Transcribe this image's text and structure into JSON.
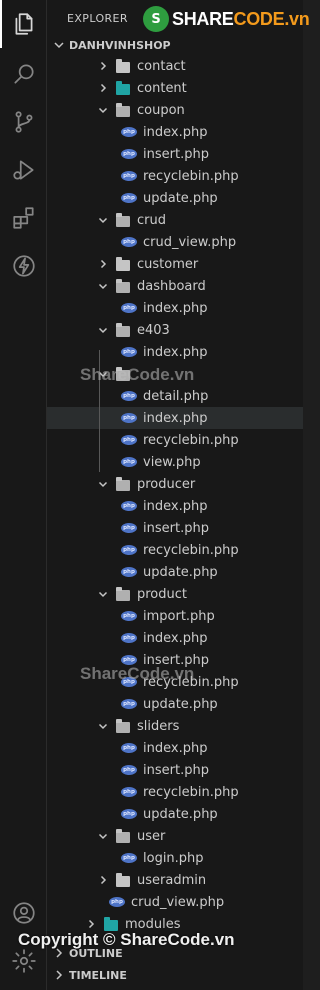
{
  "sidebar": {
    "title": "EXPLORER",
    "logo_text_a": "SHARE",
    "logo_text_b": "CODE.vn",
    "root_label": "DANHVINHSHOP"
  },
  "tree": [
    {
      "label": "contact",
      "kind": "folder",
      "state": "collapsed",
      "depth": 1
    },
    {
      "label": "content",
      "kind": "folder",
      "state": "collapsed",
      "depth": 1,
      "color": "teal"
    },
    {
      "label": "coupon",
      "kind": "folder",
      "state": "expanded",
      "depth": 1
    },
    {
      "label": "index.php",
      "kind": "php",
      "depth": 2
    },
    {
      "label": "insert.php",
      "kind": "php",
      "depth": 2
    },
    {
      "label": "recyclebin.php",
      "kind": "php",
      "depth": 2
    },
    {
      "label": "update.php",
      "kind": "php",
      "depth": 2
    },
    {
      "label": "crud",
      "kind": "folder",
      "state": "expanded",
      "depth": 1
    },
    {
      "label": "crud_view.php",
      "kind": "php",
      "depth": 2
    },
    {
      "label": "customer",
      "kind": "folder",
      "state": "collapsed",
      "depth": 1
    },
    {
      "label": "dashboard",
      "kind": "folder",
      "state": "expanded",
      "depth": 1
    },
    {
      "label": "index.php",
      "kind": "php",
      "depth": 2
    },
    {
      "label": "e403",
      "kind": "folder",
      "state": "expanded",
      "depth": 1
    },
    {
      "label": "index.php",
      "kind": "php",
      "depth": 2
    },
    {
      "label": "",
      "kind": "folder",
      "state": "expanded",
      "depth": 1
    },
    {
      "label": "detail.php",
      "kind": "php",
      "depth": 2
    },
    {
      "label": "index.php",
      "kind": "php",
      "depth": 2,
      "selected": true
    },
    {
      "label": "recyclebin.php",
      "kind": "php",
      "depth": 2
    },
    {
      "label": "view.php",
      "kind": "php",
      "depth": 2
    },
    {
      "label": "producer",
      "kind": "folder",
      "state": "expanded",
      "depth": 1
    },
    {
      "label": "index.php",
      "kind": "php",
      "depth": 2
    },
    {
      "label": "insert.php",
      "kind": "php",
      "depth": 2
    },
    {
      "label": "recyclebin.php",
      "kind": "php",
      "depth": 2
    },
    {
      "label": "update.php",
      "kind": "php",
      "depth": 2
    },
    {
      "label": "product",
      "kind": "folder",
      "state": "expanded",
      "depth": 1
    },
    {
      "label": "import.php",
      "kind": "php",
      "depth": 2
    },
    {
      "label": "index.php",
      "kind": "php",
      "depth": 2
    },
    {
      "label": "insert.php",
      "kind": "php",
      "depth": 2
    },
    {
      "label": "recyclebin.php",
      "kind": "php",
      "depth": 2
    },
    {
      "label": "update.php",
      "kind": "php",
      "depth": 2
    },
    {
      "label": "sliders",
      "kind": "folder",
      "state": "expanded",
      "depth": 1
    },
    {
      "label": "index.php",
      "kind": "php",
      "depth": 2
    },
    {
      "label": "insert.php",
      "kind": "php",
      "depth": 2
    },
    {
      "label": "recyclebin.php",
      "kind": "php",
      "depth": 2
    },
    {
      "label": "update.php",
      "kind": "php",
      "depth": 2
    },
    {
      "label": "user",
      "kind": "folder",
      "state": "expanded",
      "depth": 1
    },
    {
      "label": "login.php",
      "kind": "php",
      "depth": 2
    },
    {
      "label": "useradmin",
      "kind": "folder",
      "state": "collapsed",
      "depth": 1
    },
    {
      "label": "crud_view.php",
      "kind": "php",
      "depth": 1
    },
    {
      "label": "modules",
      "kind": "folder",
      "state": "collapsed",
      "depth": 0,
      "color": "teal"
    }
  ],
  "sections": {
    "outline": "OUTLINE",
    "timeline": "TIMELINE"
  },
  "watermarks": {
    "mid": "ShareCode.vn",
    "copyright": "Copyright © ShareCode.vn"
  },
  "icons": {
    "activity": [
      "explorer-icon",
      "search-icon",
      "source-control-icon",
      "run-debug-icon",
      "extensions-icon",
      "thunder-icon",
      "account-icon",
      "settings-gear-icon"
    ]
  },
  "colors": {
    "php_badge": "#4e74c7",
    "selection": "#2a2d2e",
    "background": "#181818"
  }
}
